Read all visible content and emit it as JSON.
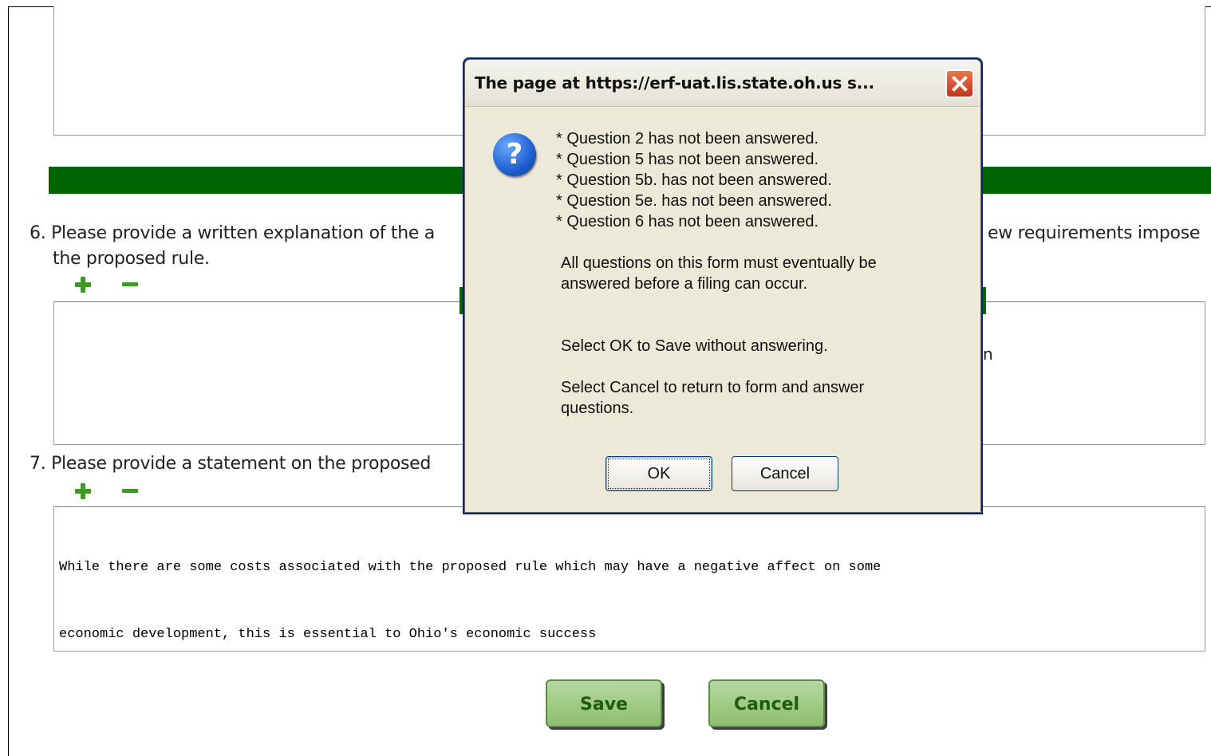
{
  "form": {
    "question6_left": "6. Please provide a written explanation of the a",
    "question6_right": "ew requirements impose",
    "question6_line2": "the proposed rule.",
    "question7": "7. Please provide a statement on the proposed",
    "answer7_line1": "While there are some costs associated with the proposed rule which may have a negative affect on some",
    "answer7_line2": "economic development, this is essential to Ohio's economic success",
    "fragment": "n",
    "save_label": "Save",
    "cancel_label": "Cancel"
  },
  "dialog": {
    "title": "The page at https://erf-uat.lis.state.oh.us s...",
    "icon": "question-icon",
    "messages": [
      "* Question 2 has not been answered.",
      "* Question 5 has not been answered.",
      "* Question 5b. has not been answered.",
      "* Question 5e. has not been answered.",
      "* Question 6 has not been answered."
    ],
    "para1": "All questions on this form  must eventually be answered before a filing can occur.",
    "para2": "Select OK to Save without answering.",
    "para3": "Select Cancel to return to form and answer questions.",
    "ok_label": "OK",
    "cancel_label": "Cancel"
  },
  "colors": {
    "accent_green": "#006400",
    "button_green": "#8dbf6e",
    "xp_blue": "#0a246a"
  }
}
